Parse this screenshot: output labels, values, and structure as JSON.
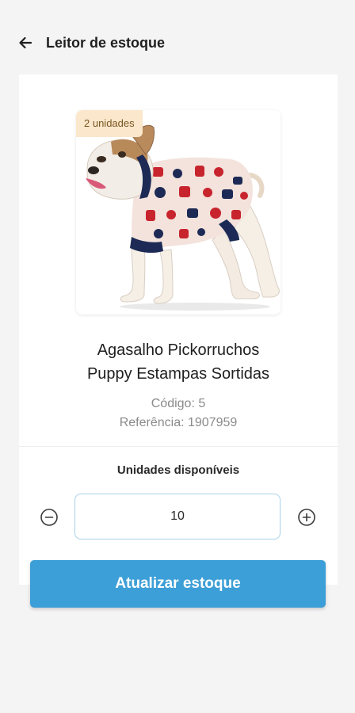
{
  "header": {
    "back_icon": "arrow-left-icon",
    "title": "Leitor de estoque"
  },
  "product": {
    "badge": "2 unidades",
    "image_alt": "Cão bulldog francês vestindo agasalho estampado",
    "name_line1": "Agasalho Pickorruchos",
    "name_line2": "Puppy Estampas Sortidas",
    "code": "Código: 5",
    "reference": "Referência: 1907959"
  },
  "stock": {
    "label": "Unidades disponíveis",
    "value": "10",
    "minus_icon": "minus-circle-icon",
    "plus_icon": "plus-circle-icon"
  },
  "actions": {
    "update_label": "Atualizar estoque"
  },
  "colors": {
    "background": "#f4f4f5",
    "accent": "#3d9fd7",
    "badge_bg": "#fbe7cb",
    "badge_text": "#7a5622",
    "input_border": "#a9d2ea"
  }
}
